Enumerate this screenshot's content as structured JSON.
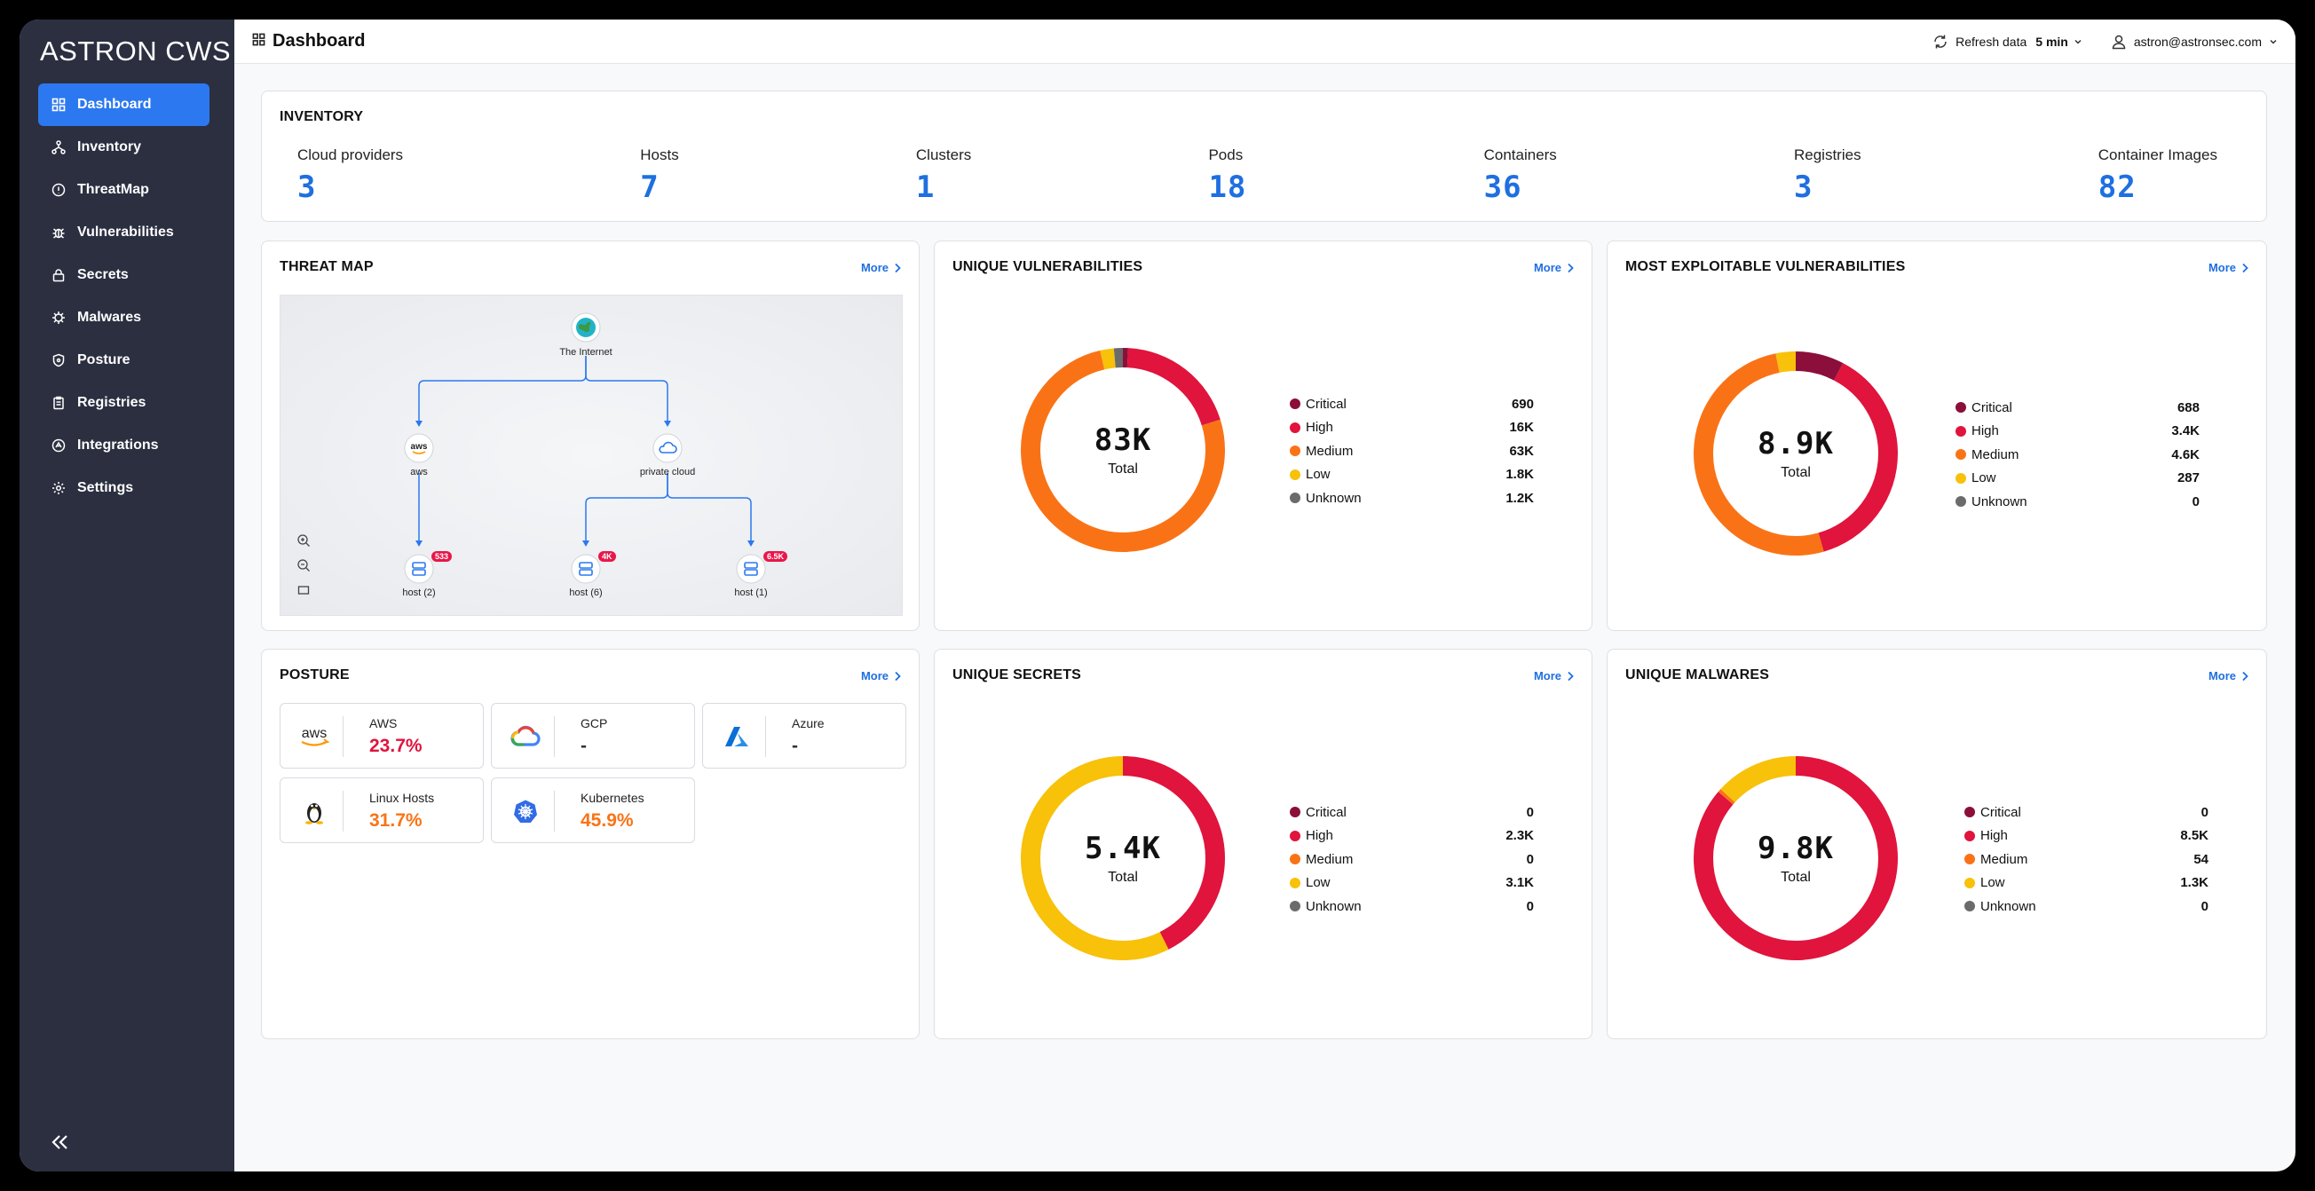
{
  "app": {
    "brand": "ASTRON CWS"
  },
  "sidebar": {
    "items": [
      {
        "label": "Dashboard",
        "icon": "grid-icon"
      },
      {
        "label": "Inventory",
        "icon": "hierarchy-icon"
      },
      {
        "label": "ThreatMap",
        "icon": "alert-circle-icon"
      },
      {
        "label": "Vulnerabilities",
        "icon": "bug-icon"
      },
      {
        "label": "Secrets",
        "icon": "lock-icon"
      },
      {
        "label": "Malwares",
        "icon": "virus-icon"
      },
      {
        "label": "Posture",
        "icon": "shield-icon"
      },
      {
        "label": "Registries",
        "icon": "clipboard-icon"
      },
      {
        "label": "Integrations",
        "icon": "plug-icon"
      },
      {
        "label": "Settings",
        "icon": "gear-icon"
      }
    ],
    "active_index": 0
  },
  "topbar": {
    "title": "Dashboard",
    "refresh_label": "Refresh data",
    "refresh_interval": "5 min",
    "user_email": "astron@astronsec.com"
  },
  "inventory": {
    "title": "INVENTORY",
    "items": [
      {
        "label": "Cloud providers",
        "value": "3"
      },
      {
        "label": "Hosts",
        "value": "7"
      },
      {
        "label": "Clusters",
        "value": "1"
      },
      {
        "label": "Pods",
        "value": "18"
      },
      {
        "label": "Containers",
        "value": "36"
      },
      {
        "label": "Registries",
        "value": "3"
      },
      {
        "label": "Container Images",
        "value": "82"
      }
    ]
  },
  "more_label": "More",
  "threat_map": {
    "title": "THREAT MAP",
    "nodes": {
      "internet": "The Internet",
      "aws": "aws",
      "aws_logo_text": "aws",
      "private_cloud": "private cloud",
      "host_a": "host (2)",
      "host_b": "host (6)",
      "host_c": "host (1)"
    },
    "badges": {
      "host_a": "533",
      "host_b": "4K",
      "host_c": "6.5K"
    }
  },
  "legend_labels": [
    "Critical",
    "High",
    "Medium",
    "Low",
    "Unknown"
  ],
  "colors": {
    "Critical": "#8b0f3a",
    "High": "#e0143c",
    "Medium": "#f97316",
    "Low": "#f8c10a",
    "Unknown": "#6b6b6b",
    "accent": "#2c78f0"
  },
  "donuts": {
    "unique_vulnerabilities": {
      "title": "UNIQUE VULNERABILITIES",
      "total": "83K",
      "total_label": "Total",
      "values_text": [
        "690",
        "16K",
        "63K",
        "1.8K",
        "1.2K"
      ],
      "values": [
        690,
        16000,
        63000,
        1800,
        1200
      ]
    },
    "most_exploitable": {
      "title": "MOST EXPLOITABLE VULNERABILITIES",
      "total": "8.9K",
      "total_label": "Total",
      "values_text": [
        "688",
        "3.4K",
        "4.6K",
        "287",
        "0"
      ],
      "values": [
        688,
        3400,
        4600,
        287,
        0
      ]
    },
    "unique_secrets": {
      "title": "UNIQUE SECRETS",
      "total": "5.4K",
      "total_label": "Total",
      "values_text": [
        "0",
        "2.3K",
        "0",
        "3.1K",
        "0"
      ],
      "values": [
        0,
        2300,
        0,
        3100,
        0
      ]
    },
    "unique_malwares": {
      "title": "UNIQUE MALWARES",
      "total": "9.8K",
      "total_label": "Total",
      "values_text": [
        "0",
        "8.5K",
        "54",
        "1.3K",
        "0"
      ],
      "values": [
        0,
        8500,
        54,
        1300,
        0
      ]
    }
  },
  "posture": {
    "title": "POSTURE",
    "items": [
      {
        "name": "AWS",
        "value": "23.7%",
        "color": "#e0143c",
        "icon": "aws-logo-icon"
      },
      {
        "name": "GCP",
        "value": "-",
        "color": "#333333",
        "icon": "gcp-logo-icon"
      },
      {
        "name": "Azure",
        "value": "-",
        "color": "#333333",
        "icon": "azure-logo-icon"
      },
      {
        "name": "Linux Hosts",
        "value": "31.7%",
        "color": "#f97316",
        "icon": "linux-logo-icon"
      },
      {
        "name": "Kubernetes",
        "value": "45.9%",
        "color": "#f97316",
        "icon": "kubernetes-logo-icon"
      }
    ],
    "aws_logo_text": "aws"
  }
}
